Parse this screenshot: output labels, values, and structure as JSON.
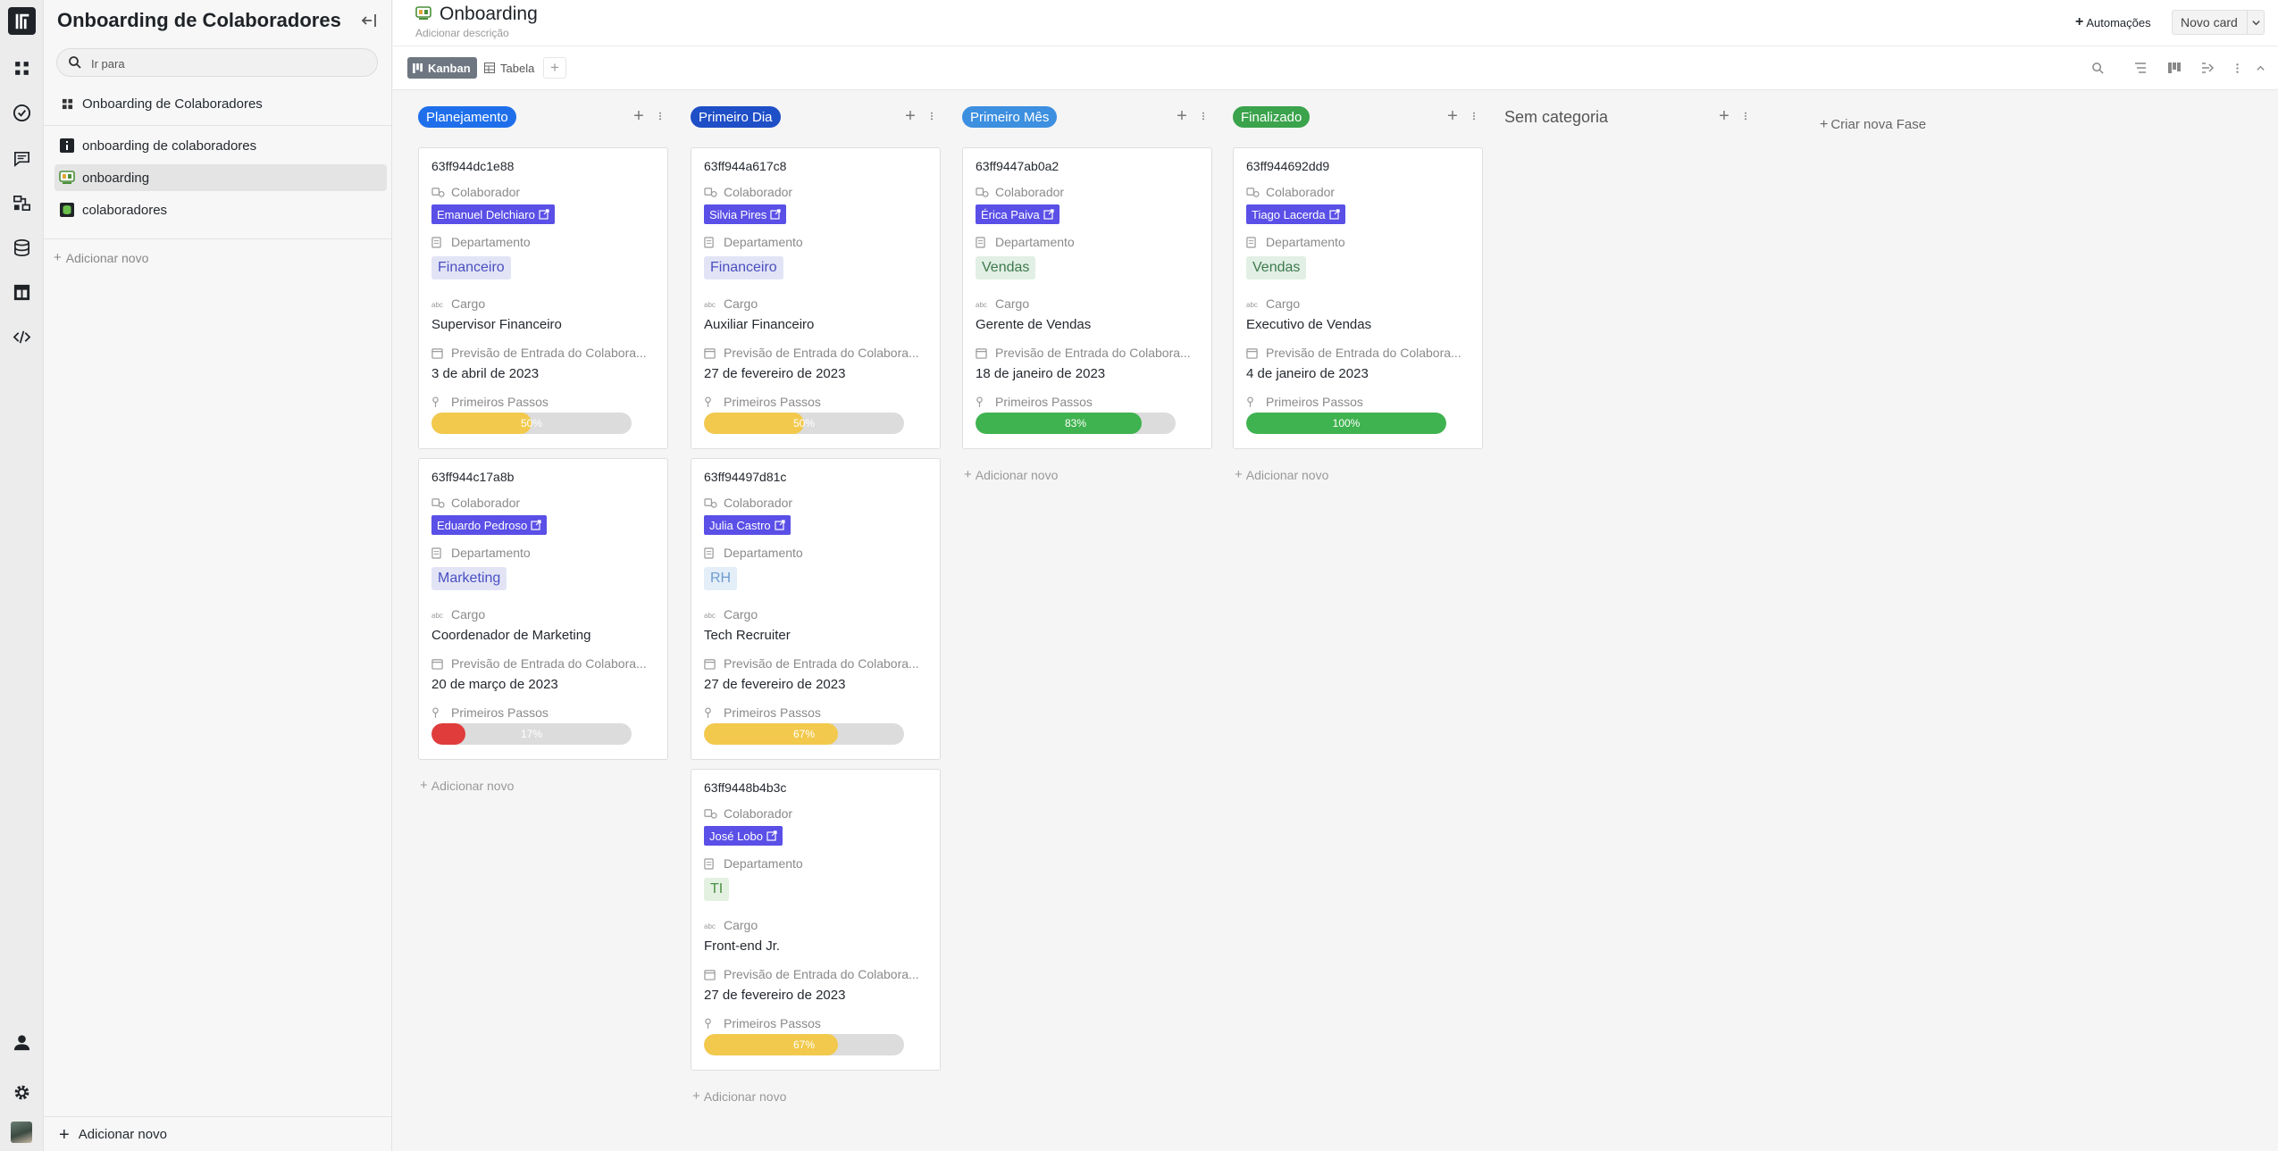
{
  "sidebar": {
    "title": "Onboarding de Colaboradores",
    "search_placeholder": "Ir para",
    "items": [
      {
        "label": "Onboarding de Colaboradores",
        "icon": "dashboard-icon"
      },
      {
        "label": "onboarding de colaboradores",
        "icon": "info-icon"
      },
      {
        "label": "onboarding",
        "icon": "board-icon"
      },
      {
        "label": "colaboradores",
        "icon": "database-icon"
      }
    ],
    "add_label": "Adicionar novo",
    "bottom_add_label": "Adicionar novo"
  },
  "page": {
    "title": "Onboarding",
    "description_placeholder": "Adicionar descrição",
    "automations_label": "Automações",
    "new_card_label": "Novo card"
  },
  "views": {
    "kanban_label": "Kanban",
    "table_label": "Tabela"
  },
  "colors": {
    "person_tag": "#5a4fe6",
    "progress_yellow": "#f2c94c",
    "progress_green": "#3fb34f",
    "progress_red": "#e03c3c"
  },
  "field_labels": {
    "colaborador": "Colaborador",
    "departamento": "Departamento",
    "cargo": "Cargo",
    "previsao": "Previsão de Entrada do Colabora...",
    "primeiros_passos": "Primeiros Passos"
  },
  "board": {
    "add_card_label": "Adicionar novo",
    "create_phase_label": "Criar nova Fase",
    "columns": [
      {
        "name": "Planejamento",
        "color": "#1f6feb",
        "cards": [
          {
            "id": "63ff944dc1e88",
            "colaborador": "Emanuel Delchiaro",
            "departamento": "Financeiro",
            "cargo": "Supervisor Financeiro",
            "previsao": "3 de abril de 2023",
            "progress_label": "50%",
            "progress": 0.5
          },
          {
            "id": "63ff944c17a8b",
            "colaborador": "Eduardo Pedroso",
            "departamento": "Marketing",
            "cargo": "Coordenador de Marketing",
            "previsao": "20 de março de 2023",
            "progress_label": "17%",
            "progress": 0.17
          }
        ]
      },
      {
        "name": "Primeiro Dia",
        "color": "#1f4fc7",
        "cards": [
          {
            "id": "63ff944a617c8",
            "colaborador": "Silvia Pires",
            "departamento": "Financeiro",
            "cargo": "Auxiliar Financeiro",
            "previsao": "27 de fevereiro de 2023",
            "progress_label": "50%",
            "progress": 0.5
          },
          {
            "id": "63ff94497d81c",
            "colaborador": "Julia Castro",
            "departamento": "RH",
            "cargo": "Tech Recruiter",
            "previsao": "27 de fevereiro de 2023",
            "progress_label": "67%",
            "progress": 0.67
          },
          {
            "id": "63ff9448b4b3c",
            "colaborador": "José Lobo",
            "departamento": "TI",
            "cargo": "Front-end Jr.",
            "previsao": "27 de fevereiro de 2023",
            "progress_label": "67%",
            "progress": 0.67
          }
        ]
      },
      {
        "name": "Primeiro Mês",
        "color": "#3d8fe0",
        "cards": [
          {
            "id": "63ff9447ab0a2",
            "colaborador": "Érica Paiva",
            "departamento": "Vendas",
            "cargo": "Gerente de Vendas",
            "previsao": "18 de janeiro de 2023",
            "progress_label": "83%",
            "progress": 0.83
          }
        ]
      },
      {
        "name": "Finalizado",
        "color": "#3aa34b",
        "cards": [
          {
            "id": "63ff944692dd9",
            "colaborador": "Tiago Lacerda",
            "departamento": "Vendas",
            "cargo": "Executivo de Vendas",
            "previsao": "4 de janeiro de 2023",
            "progress_label": "100%",
            "progress": 1.0
          }
        ]
      },
      {
        "name": "Sem categoria",
        "color": "",
        "cards": []
      }
    ]
  }
}
